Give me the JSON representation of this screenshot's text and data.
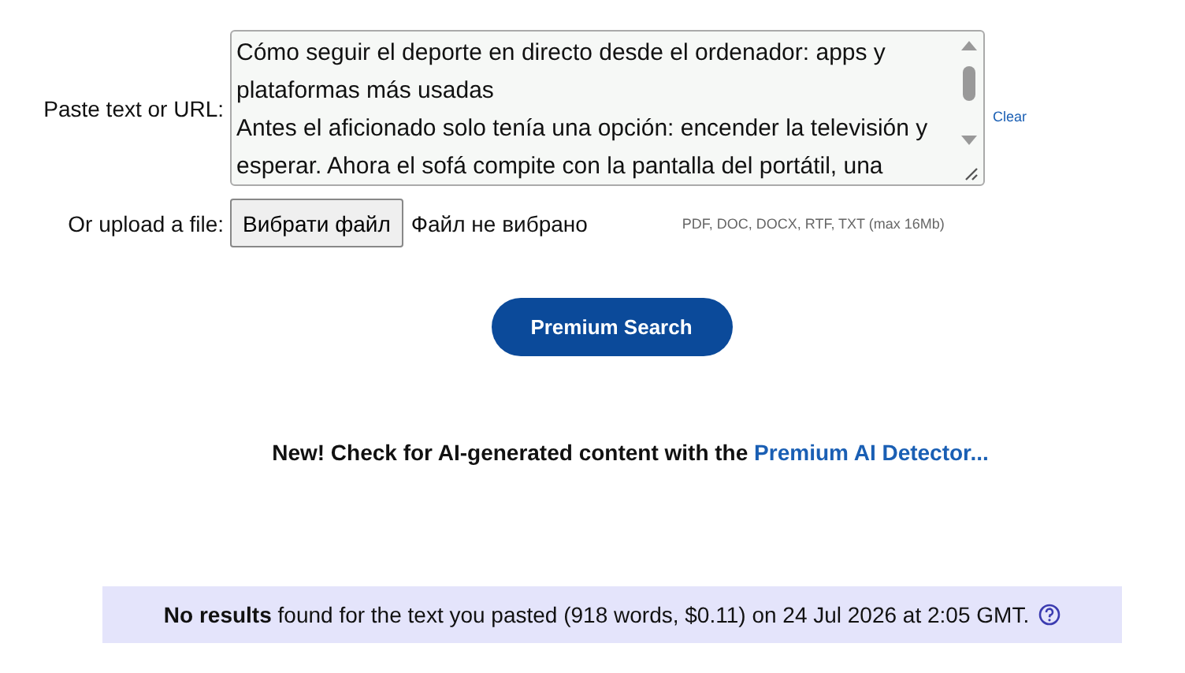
{
  "paste": {
    "label": "Paste text or URL:",
    "value": [
      "Cómo seguir el deporte en directo desde el ordenador: apps y plataformas más usadas",
      "Antes el aficionado solo tenía una opción: encender la televisión y esperar. Ahora el sofá compite con la pantalla del portátil, una"
    ],
    "clear": "Clear"
  },
  "upload": {
    "label": "Or upload a file:",
    "button": "Вибрати файл",
    "status": "Файл не вибрано",
    "formats": "PDF, DOC, DOCX, RTF, TXT (max 16Mb)"
  },
  "search_button": "Premium Search",
  "promo": {
    "text": "**New! Check for AI-generated content with the**",
    "link": "Premium AI Detector..."
  },
  "result": {
    "text": "**No results** found for the text you pasted (918 words, $0.11) on 24 Jul 2026 at 2:05 GMT."
  }
}
